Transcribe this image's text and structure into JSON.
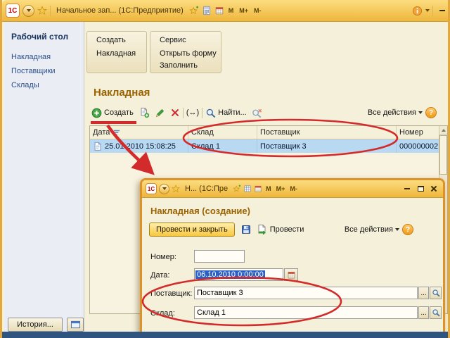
{
  "window": {
    "logo": "1С",
    "title": "Начальное зап... (1С:Предприятие)",
    "memory": [
      "M",
      "M+",
      "M-"
    ]
  },
  "sidebar": {
    "title": "Рабочий стол",
    "items": [
      "Накладная",
      "Поставщики",
      "Склады"
    ]
  },
  "panels": {
    "create": {
      "title": "Создать",
      "items": [
        "Накладная"
      ]
    },
    "service": {
      "title": "Сервис",
      "items": [
        "Открыть форму",
        "Заполнить"
      ]
    }
  },
  "list": {
    "heading": "Накладная",
    "toolbar": {
      "create": "Создать",
      "interval_icon": "(↔)",
      "find": "Найти...",
      "all_actions": "Все действия",
      "help": "?"
    },
    "columns": {
      "date": "Дата",
      "warehouse": "Склад",
      "supplier": "Поставщик",
      "number": "Номер"
    },
    "row": {
      "date": "25.01.2010 15:08:25",
      "warehouse": "Склад 1",
      "supplier": "Поставщик 3",
      "number": "000000002"
    }
  },
  "dialog": {
    "logo": "1С",
    "title": "Н... (1С:Пре",
    "memory": [
      "M",
      "M+",
      "M-"
    ],
    "heading": "Накладная (создание)",
    "commands": {
      "post_and_close": "Провести и закрыть",
      "post": "Провести",
      "all_actions": "Все действия",
      "help": "?"
    },
    "fields": {
      "number_label": "Номер:",
      "number_value": "",
      "date_label": "Дата:",
      "date_value": "06.10.2010 0:00:00",
      "supplier_label": "Поставщик:",
      "supplier_value": "Поставщик 3",
      "warehouse_label": "Склад:",
      "warehouse_value": "Склад 1",
      "ellipsis": "..."
    }
  },
  "footer": {
    "history": "История..."
  }
}
